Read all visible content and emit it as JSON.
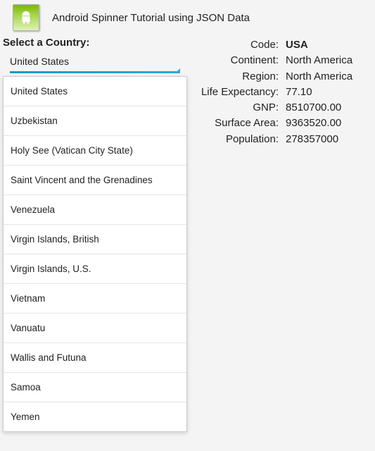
{
  "header": {
    "title": "Android Spinner Tutorial using JSON Data"
  },
  "spinner": {
    "label": "Select a Country:",
    "selected": "United States",
    "options": [
      "United States",
      "Uzbekistan",
      "Holy See (Vatican City State)",
      "Saint Vincent and the Grenadines",
      "Venezuela",
      "Virgin Islands, British",
      "Virgin Islands, U.S.",
      "Vietnam",
      "Vanuatu",
      "Wallis and Futuna",
      "Samoa",
      "Yemen"
    ]
  },
  "details": {
    "code_label": "Code:",
    "code_value": "USA",
    "continent_label": "Continent:",
    "continent_value": "North America",
    "region_label": "Region:",
    "region_value": "North America",
    "life_label": "Life Expectancy:",
    "life_value": "77.10",
    "gnp_label": "GNP:",
    "gnp_value": "8510700.00",
    "surface_label": "Surface Area:",
    "surface_value": "9363520.00",
    "population_label": "Population:",
    "population_value": "278357000"
  }
}
